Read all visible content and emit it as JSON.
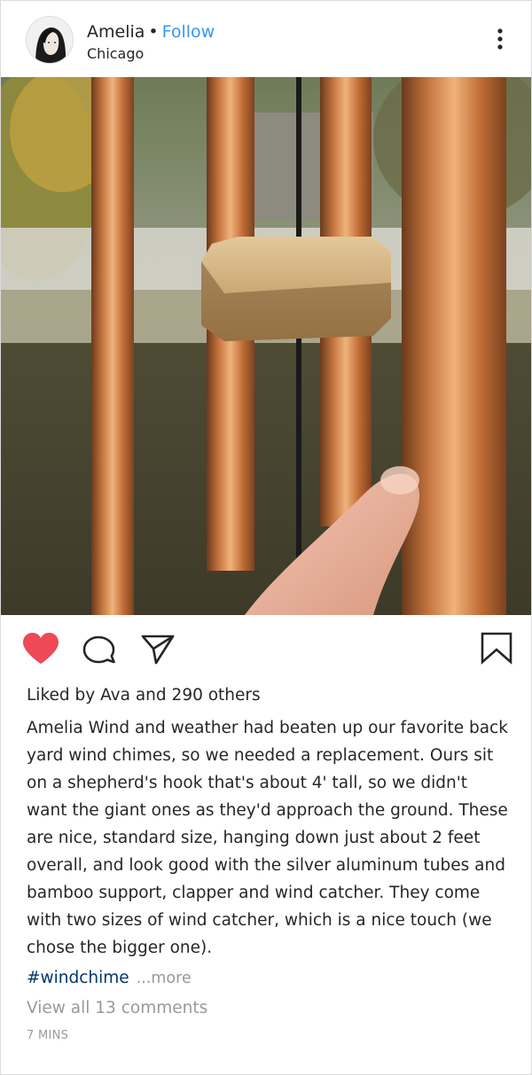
{
  "header": {
    "username": "Amelia",
    "separator": "•",
    "follow_label": "Follow",
    "location": "Chicago"
  },
  "actions": {
    "like_active": true,
    "like_color": "#ed4956",
    "icons": [
      "heart-icon",
      "comment-icon",
      "share-icon",
      "bookmark-icon"
    ]
  },
  "likes": {
    "prefix": "Liked by",
    "first_liker": "Ava",
    "joiner": "and",
    "others": "290 others"
  },
  "caption": {
    "username": "Amelia",
    "text": "Wind and weather had beaten up our favorite back yard wind chimes, so we needed a replacement. Ours sit on a shepherd's hook that's about 4' tall, so we didn't want the giant ones as they'd approach the ground. These are nice, standard size, hanging down just about 2 feet overall, and look good with the silver aluminum tubes and bamboo support, clapper and wind catcher. They come with two sizes of wind catcher, which is a nice touch (we chose the bigger one).",
    "hashtag": "#windchime",
    "more_label": "...more"
  },
  "comments_label": "View all 13 comments",
  "timestamp": "7 MINS",
  "colors": {
    "link_blue": "#3897f0",
    "hashtag_blue": "#003569",
    "muted_gray": "#999999"
  }
}
